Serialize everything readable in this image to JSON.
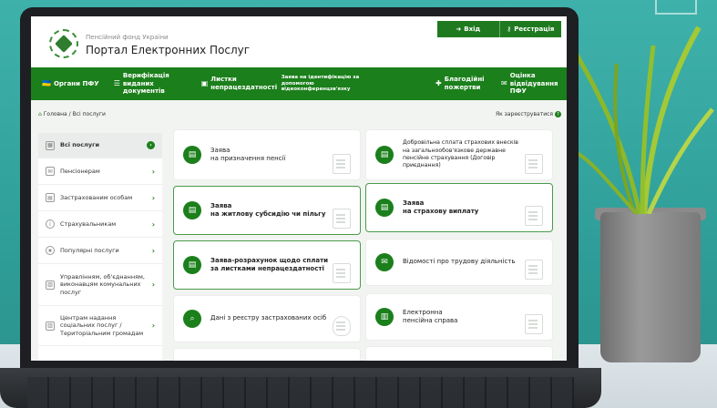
{
  "header": {
    "org_name": "Пенсійний фонд України",
    "portal_title": "Портал Електронних Послуг",
    "login_label": "Вхід",
    "register_label": "Реєстрація"
  },
  "nav": {
    "items": [
      {
        "label": "Органи ПФУ",
        "icon": "flag-icon"
      },
      {
        "label": "Верифікація виданих документів",
        "icon": "list-icon"
      },
      {
        "label": "Листки непрацездатності",
        "icon": "briefcase-icon"
      },
      {
        "label": "Заява на ідентифікацію за допомогою відеоконференцзв'язку",
        "icon": ""
      },
      {
        "label": "Благодійні пожертви",
        "icon": "gift-icon"
      },
      {
        "label": "Оцінка відвідування ПФУ",
        "icon": "chat-icon"
      }
    ]
  },
  "breadcrumb": {
    "home": "Головна",
    "separator": "/",
    "current": "Всі послуги"
  },
  "login_hint": "Як зареєструватися",
  "sidebar": {
    "items": [
      {
        "label": "Всі послуги"
      },
      {
        "label": "Пенсіонерам"
      },
      {
        "label": "Застрахованим особам"
      },
      {
        "label": "Страхувальникам"
      },
      {
        "label": "Популярні послуги"
      },
      {
        "label": "Управлінням, об'єднанням, виконавцям комунальних послуг"
      },
      {
        "label": "Центрам надання соціальних послуг / Територіальним громадам"
      }
    ]
  },
  "cards": [
    {
      "line1": "Заява",
      "line2": "на призначення пенсії"
    },
    {
      "line1": "Добровільна сплата страхових внесків на загальнообов'язкове державне пенсійне страхування (Договір приєднання)"
    },
    {
      "line1": "Заява",
      "line2": "на житлову субсидію чи пільгу"
    },
    {
      "line1": "Заява",
      "line2": "на страхову виплату"
    },
    {
      "line1": "Заява-розрахунок щодо сплати за листками непрацездатності"
    },
    {
      "line1": "Відомості про трудову діяльність"
    },
    {
      "line1": "Дані з реєстру застрахованих осіб"
    },
    {
      "line1": "Електронна",
      "line2": "пенсійна справа"
    }
  ],
  "colors": {
    "brand_green": "#1b7f1b",
    "background_teal": "#3aa9a2"
  }
}
